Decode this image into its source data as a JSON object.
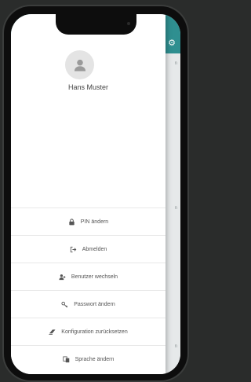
{
  "background": {
    "header_color": "#2f8f90",
    "gear_icon": "gear-icon",
    "edge_letters": [
      "n",
      "n",
      "n"
    ]
  },
  "drawer": {
    "user": {
      "name": "Hans Muster",
      "avatar_icon": "user-icon"
    },
    "menu": [
      {
        "id": "pin-aendern",
        "label": "PIN ändern",
        "icon": "lock-icon"
      },
      {
        "id": "abmelden",
        "label": "Abmelden",
        "icon": "logout-icon"
      },
      {
        "id": "benutzer-wechseln",
        "label": "Benutzer wechseln",
        "icon": "user-switch-icon"
      },
      {
        "id": "passwort-aendern",
        "label": "Passwort ändern",
        "icon": "key-icon"
      },
      {
        "id": "konfiguration-zuruecksetzen",
        "label": "Konfiguration zurücksetzen",
        "icon": "eraser-icon"
      },
      {
        "id": "sprache-aendern",
        "label": "Sprache ändern",
        "icon": "language-icon"
      }
    ]
  }
}
